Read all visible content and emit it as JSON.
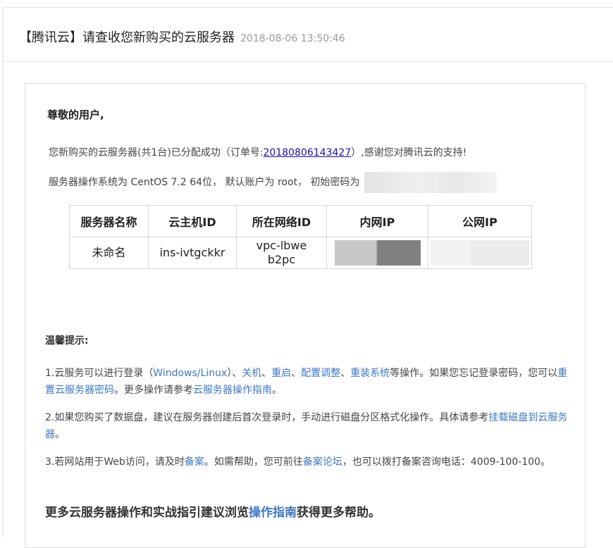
{
  "subject": {
    "title": "【腾讯云】请查收您新购买的云服务器",
    "time": "2018-08-06 13:50:46"
  },
  "mail": {
    "greeting": "尊敬的用户,",
    "line1_pre": "您新购买的云服务器(共1台)已分配成功（订单号:",
    "order_no": "20180806143427",
    "line1_post": "）,感谢您对腾讯云的支持!",
    "line2": "服务器操作系统为 CentOS 7.2 64位， 默认账户为 root， 初始密码为",
    "table": {
      "headers": [
        "服务器名称",
        "云主机ID",
        "所在网络ID",
        "内网IP",
        "公网IP"
      ],
      "row": {
        "name": "未命名",
        "instance_id": "ins-ivtgckkr",
        "vpc_id": "vpc-lbweb2pc"
      }
    },
    "tips_title": "温馨提示:",
    "tip1": {
      "t1": "1.云服务可以进行登录（",
      "link_login": "Windows/Linux",
      "t2": "）、",
      "link_shutdown": "关机",
      "t3": "、",
      "link_restart": "重启",
      "t4": "、",
      "link_config": "配置调整",
      "t5": "、",
      "link_reinstall": "重装系统",
      "t6": "等操作。如果您忘记登录密码，您可以",
      "link_reset": "重置云服务器密码",
      "t7": "。更多操作请参考",
      "link_guide": "云服务器操作指南",
      "t8": "。"
    },
    "tip2": {
      "t1": "2.如果您购买了数据盘，建议在服务器创建后首次登录时，手动进行磁盘分区格式化操作。具体请参考",
      "link_mount": "挂载磁盘到云服务器",
      "t2": "。"
    },
    "tip3": {
      "t1": "3.若网站用于Web访问，请及时",
      "link_beian": "备案",
      "t2": "。如需帮助，您可前往",
      "link_forum": "备案论坛",
      "t3": "，也可以拨打备案咨询电话：4009-100-100。"
    },
    "footer": {
      "pre": "更多云服务器操作和实战指引建议浏览",
      "link": "操作指南",
      "post": "获得更多帮助。"
    }
  }
}
